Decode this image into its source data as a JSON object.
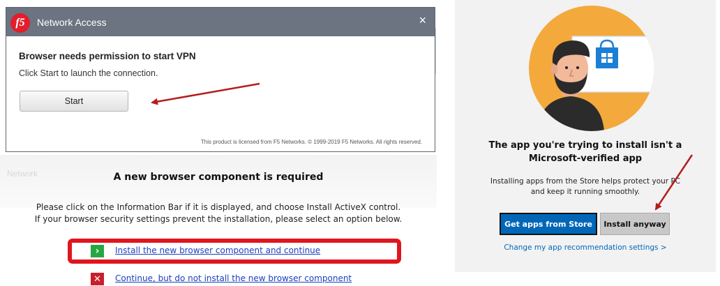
{
  "f5_dialog": {
    "title": "Network Access",
    "logo_text": "f5",
    "close_glyph": "×",
    "heading": "Browser needs permission to start VPN",
    "subtext": "Click Start to launch the connection.",
    "start_label": "Start",
    "license": "This product is licensed from F5 Networks. © 1999-2019 F5 Networks. All rights reserved."
  },
  "faded_background_text": "Network",
  "browser_component": {
    "heading": "A new browser component is required",
    "line1": "Please click on the Information Bar if it is displayed, and choose Install ActiveX control.",
    "line2": "If your browser security settings prevent the installation, please select an option below.",
    "install_icon_glyph": "›",
    "install_link": "Install the new browser component and continue",
    "skip_icon_glyph": "✕",
    "skip_link": "Continue, but do not install the new browser component"
  },
  "store_prompt": {
    "title_line1": "The app you're trying to install isn't a",
    "title_line2": "Microsoft-verified app",
    "body_line1": "Installing apps from the Store helps protect your PC",
    "body_line2": "and keep it running smoothly.",
    "get_apps_label": "Get apps from Store",
    "install_anyway_label": "Install anyway",
    "settings_link": "Change my app recommendation settings >"
  },
  "colors": {
    "f5_titlebar": "#6b7480",
    "f5_red": "#e31d2c",
    "highlight_red": "#e0151d",
    "annotation_arrow": "#b71c1c",
    "install_green": "#25a843",
    "skip_red": "#c8202b",
    "link_blue": "#1a3fbf",
    "ms_blue": "#0067b8",
    "hero_orange": "#f3a93c"
  },
  "icons": [
    "f5-logo-icon",
    "close-icon",
    "chevron-right-icon",
    "x-icon",
    "store-bag-icon",
    "annotation-arrow"
  ]
}
